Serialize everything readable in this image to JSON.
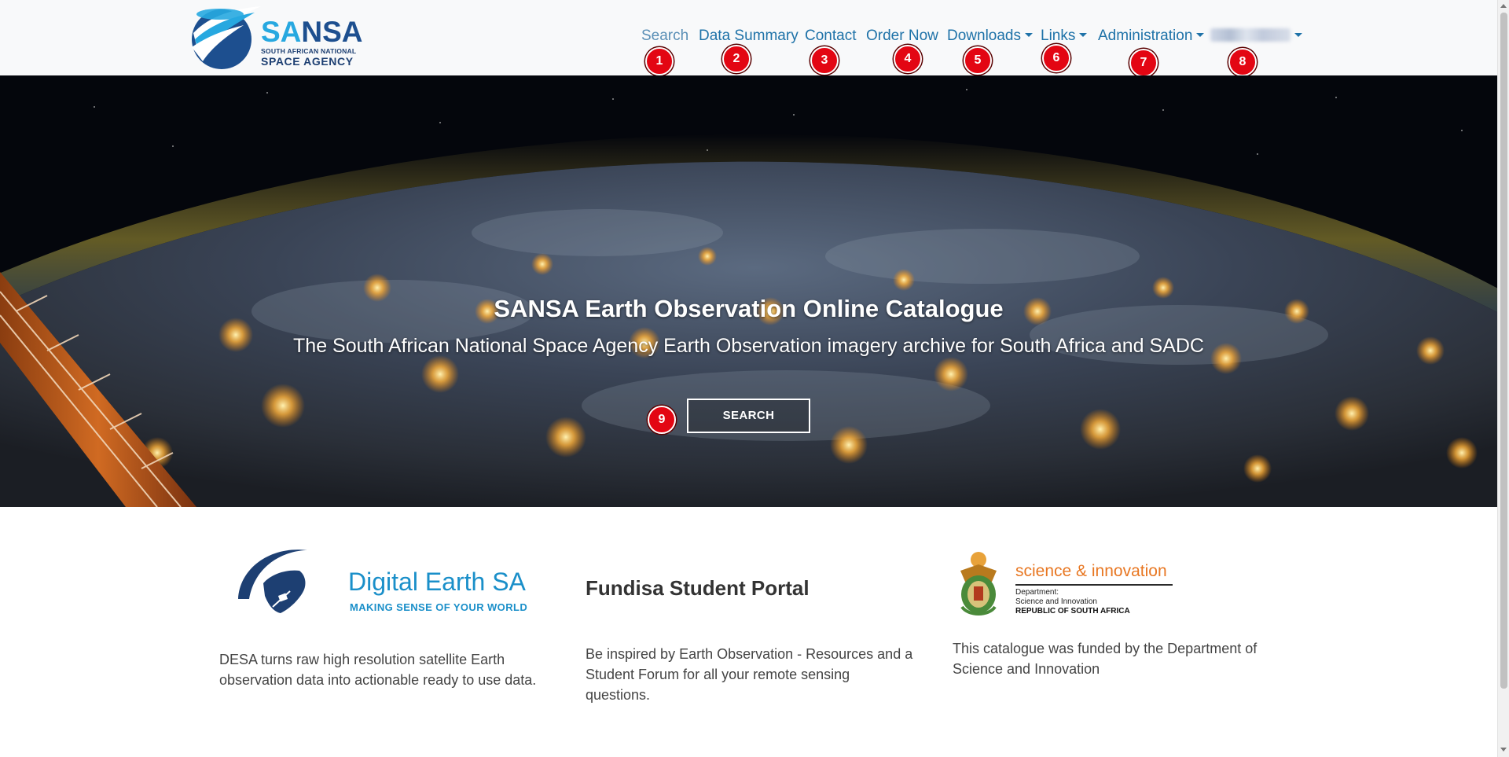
{
  "brand": {
    "name_accent": "SA",
    "name_rest": "NSA",
    "line1": "SOUTH AFRICAN NATIONAL",
    "line2": "SPACE AGENCY"
  },
  "nav": {
    "search": "Search",
    "data_summary": "Data Summary",
    "contact": "Contact",
    "order_now": "Order Now",
    "downloads": "Downloads",
    "links": "Links",
    "administration": "Administration"
  },
  "markers": [
    "1",
    "2",
    "3",
    "4",
    "5",
    "6",
    "7",
    "8",
    "9"
  ],
  "hero": {
    "title": "SANSA Earth Observation Online Catalogue",
    "subtitle": "The South African National Space Agency Earth Observation imagery archive for South Africa and SADC",
    "button": "SEARCH"
  },
  "cards": {
    "desa": {
      "logo_name": "Digital Earth SA",
      "logo_tag": "MAKING SENSE OF YOUR WORLD",
      "text": "DESA turns raw high resolution satellite Earth observation data into actionable ready to use data."
    },
    "fundisa": {
      "heading": "Fundisa Student Portal",
      "text": "Be inspired by Earth Observation - Resources and a Student Forum for all your remote sensing questions."
    },
    "dsi": {
      "logo_title": "science & innovation",
      "logo_dept_line1": "Department:",
      "logo_dept_line2": "Science and Innovation",
      "logo_country": "REPUBLIC OF SOUTH AFRICA",
      "text": "This catalogue was funded by the Department of Science and Innovation"
    }
  },
  "colors": {
    "nav_link": "#1e72a8",
    "marker": "#e30613",
    "brand_blue": "#1d4f8f",
    "brand_light": "#27a8e0",
    "dsi_orange": "#e87722"
  }
}
